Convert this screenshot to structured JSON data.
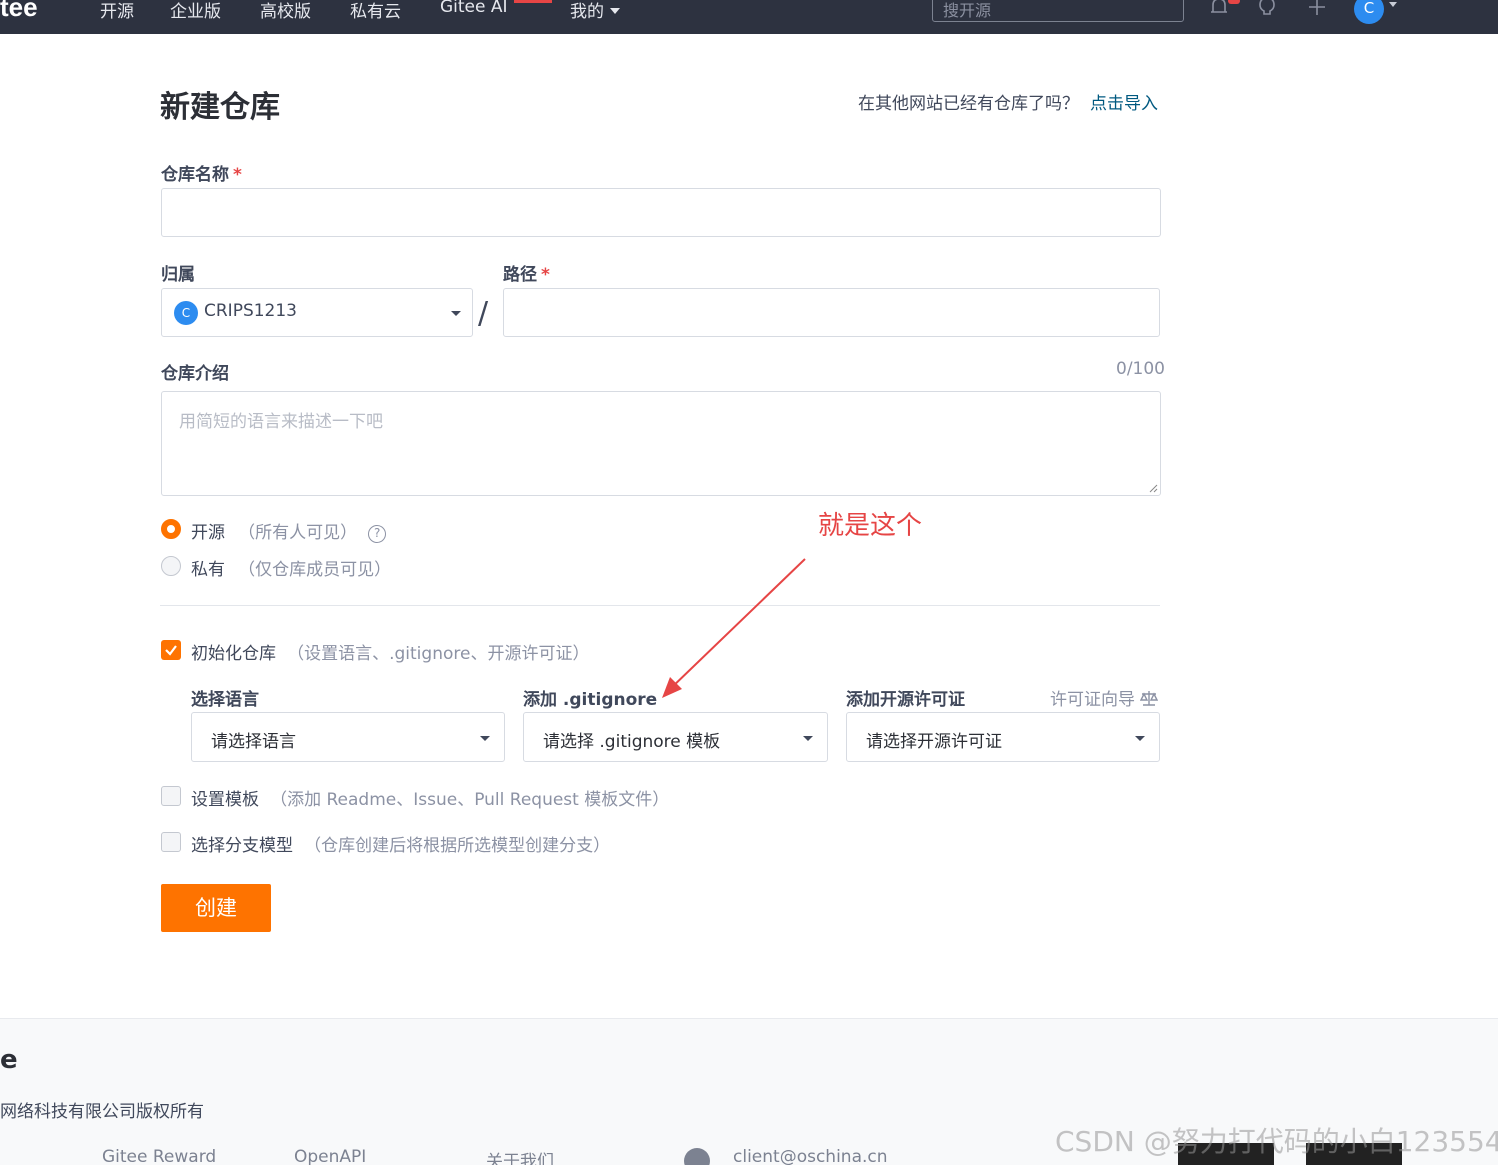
{
  "topnav": {
    "logo": "tee",
    "links": [
      "开源",
      "企业版",
      "高校版",
      "私有云",
      "Gitee AI"
    ],
    "mine": "我的",
    "search_placeholder": "搜开源",
    "avatar": "C"
  },
  "header": {
    "title": "新建仓库",
    "import_question": "在其他网站已经有仓库了吗？",
    "import_link": "点击导入"
  },
  "form": {
    "repo_name_label": "仓库名称",
    "required_mark": "*",
    "owner_label": "归属",
    "owner_avatar": "C",
    "owner_value": "CRIPS1213",
    "path_label": "路径",
    "slash": "/",
    "desc_label": "仓库介绍",
    "desc_counter": "0/100",
    "desc_placeholder": "用简短的语言来描述一下吧",
    "visibility": {
      "public_label": "开源",
      "public_hint": "（所有人可见）",
      "private_label": "私有",
      "private_hint": "（仅仓库成员可见）",
      "help_icon": "?"
    },
    "init": {
      "label": "初始化仓库",
      "hint": "（设置语言、.gitignore、开源许可证）",
      "language_label": "选择语言",
      "language_value": "请选择语言",
      "gitignore_label": "添加 .gitignore",
      "gitignore_value": "请选择 .gitignore 模板",
      "license_label": "添加开源许可证",
      "license_wizard": "许可证向导",
      "license_value": "请选择开源许可证"
    },
    "template": {
      "label": "设置模板",
      "hint": "（添加 Readme、Issue、Pull Request 模板文件）"
    },
    "branch": {
      "label": "选择分支模型",
      "hint": "（仓库创建后将根据所选模型创建分支）"
    },
    "create_button": "创建"
  },
  "annotation": {
    "text": "就是这个",
    "color": "#e64545"
  },
  "footer": {
    "logo": "e",
    "copyright": "网络科技有限公司版权所有",
    "links": [
      "Gitee Reward",
      "OpenAPI",
      "关于我们"
    ],
    "email": "client@oschina.cn"
  },
  "watermark": "CSDN @努力打代码的小白123554",
  "colors": {
    "nav_bg": "#2d3240",
    "accent": "#fe7300",
    "link": "#005980",
    "required": "#e64545"
  }
}
